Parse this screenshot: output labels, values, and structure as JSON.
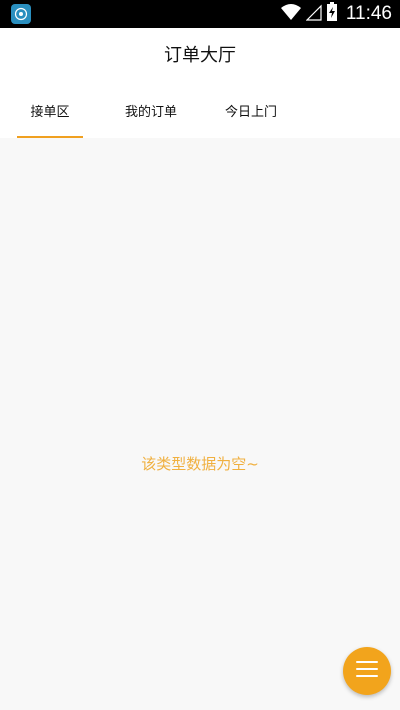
{
  "status_bar": {
    "time": "11:46",
    "icons": [
      "app-launcher-icon",
      "wifi-icon",
      "signal-icon",
      "battery-charging-icon"
    ]
  },
  "header": {
    "title": "订单大厅"
  },
  "tabs": [
    {
      "label": "接单区",
      "active": true
    },
    {
      "label": "我的订单",
      "active": false
    },
    {
      "label": "今日上门",
      "active": false
    }
  ],
  "content": {
    "empty_message": "该类型数据为空~"
  },
  "fab": {
    "icon": "menu-icon"
  },
  "colors": {
    "accent": "#f0a020",
    "empty_text": "#f0b040",
    "status_bar": "#000000"
  }
}
